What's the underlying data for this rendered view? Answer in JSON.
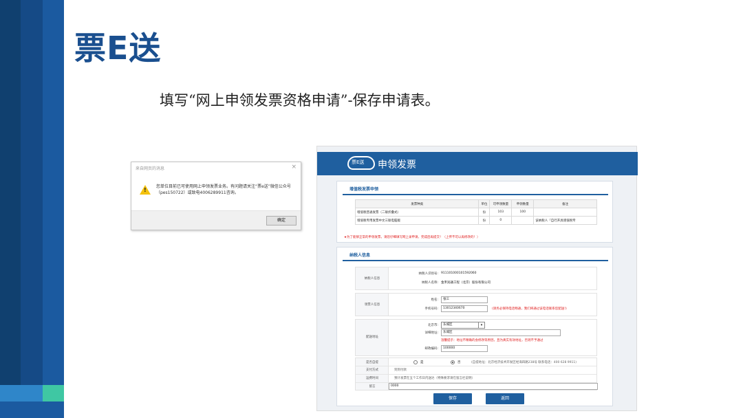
{
  "slide": {
    "title": "票E送",
    "subtitle": "填写“网上申领发票资格申请”-保存申请表。"
  },
  "dialog": {
    "title": "来自网页的消息",
    "close": "×",
    "message": "您单位目前已可使用网上申领发票业务。有问题请关注“票e送”微信公众号（pes150722）或致电4006289911咨询。",
    "ok_label": "确定"
  },
  "form": {
    "header_logo_text": "票E送",
    "header_title": "申领发票",
    "invoice_panel": {
      "title": "增值税发票申领",
      "columns": [
        "发票种类",
        "单位",
        "可申领数量",
        "申领数量",
        "备注"
      ],
      "rows": [
        {
          "type": "增值税普通发票（二联折叠式）",
          "unit": "份",
          "available": "103",
          "requested": "100",
          "remark": ""
        },
        {
          "type": "增值税专用发票中文三联电脑版",
          "unit": "份",
          "available": "0",
          "requested": "",
          "remark": "该纳税人『自行开具增值税专"
        }
      ],
      "note": "★为了能够正常的申领发票，请您仔细填写网上录申请，完成后再提交！（上传不可以再修改的！）"
    },
    "taxpayer_panel": {
      "title": "纳税人信息",
      "taxpayer_section": "纳税人信息",
      "tax_id_label": "纳税人识别号:",
      "tax_id": "911101000101592060",
      "name_label": "纳税人名称:",
      "name": "金禾润通工程（北京）股份有限公司",
      "recipient_section": "领票人信息",
      "person_label": "姓名:",
      "person": "张三",
      "phone_label": "手机号码:",
      "phone": "13012340670",
      "phone_note": "(请务必保持电话畅通，我们将通过该电话联系您配送!)",
      "address_section": "配送地址",
      "city_label": "北京市:",
      "district": "东城区",
      "detail_label": "详细地址:",
      "detail": "东城区",
      "address_note": "温馨提示：地址不精确的会修改等原因，且为真实有效地址，否则不予通过",
      "postcode_label": "邮政编码:",
      "postcode": "100000",
      "self_pick_label": "是否自提",
      "opt_yes": "是",
      "opt_no": "否",
      "self_pick_note": "(自提地址：北京经济技术开发区经海四路238号 联系电话：400 628 9911)",
      "pay_label": "支付方式",
      "pay_value": "到到付款",
      "delivery_label": "运费时间",
      "delivery_value": "預计发票在五个工作日内送达（特殊要求请在留言栏说明）",
      "message_label": "留言",
      "message_value": "0000"
    },
    "save_label": "保存",
    "back_label": "返回"
  }
}
